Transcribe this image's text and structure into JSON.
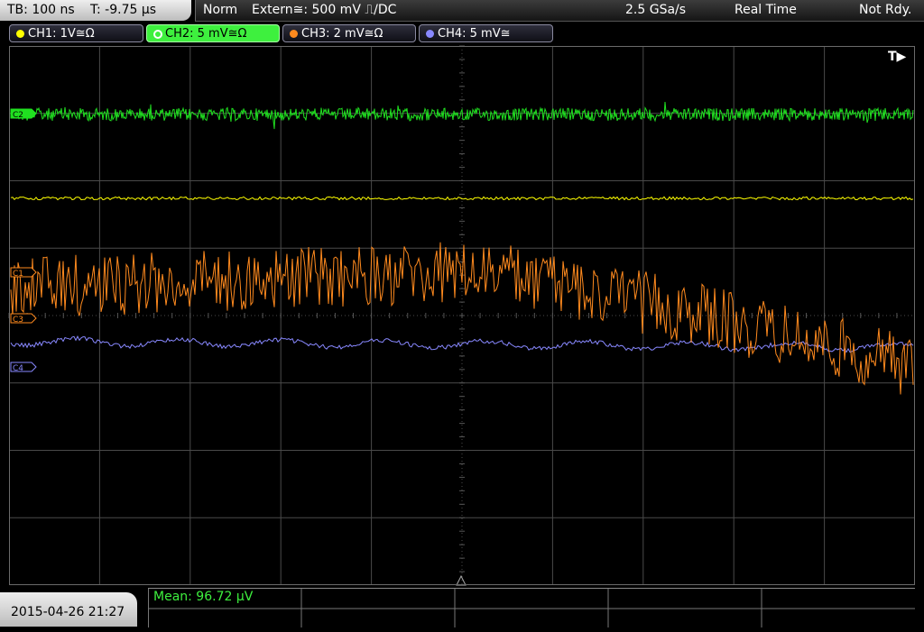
{
  "status_bar": {
    "timebase": "TB: 100 ns",
    "trigger_time": "T: -9.75 µs",
    "trigger_mode": "Norm",
    "trigger_source": "Extern≅: 500 mV ⎍/DC",
    "sample_rate": "2.5 GSa/s",
    "acquisition_mode": "Real Time",
    "trigger_status": "Not Rdy."
  },
  "channels": [
    {
      "label": "CH1: 1V≅Ω",
      "color": "#ffff00",
      "marker": "C1"
    },
    {
      "label": "CH2: 5 mV≅Ω",
      "color": "#20e020",
      "marker": "C2",
      "active": true
    },
    {
      "label": "CH3: 2 mV≅Ω",
      "color": "#ff8a1e",
      "marker": "C3"
    },
    {
      "label": "CH4: 5 mV≅",
      "color": "#8888ff",
      "marker": "C4"
    }
  ],
  "trigger_marker": "T▶",
  "datetime": "2015-04-26 21:27",
  "measurement": {
    "mean": "Mean: 96.72 µV"
  },
  "colors": {
    "ch1": "#ffff00",
    "ch2": "#20e020",
    "ch3": "#ff8a1e",
    "ch4": "#8888ff",
    "grid": "#4a4a4a"
  },
  "icons": [
    "trigger-position-icon",
    "channel-dot-icon"
  ]
}
